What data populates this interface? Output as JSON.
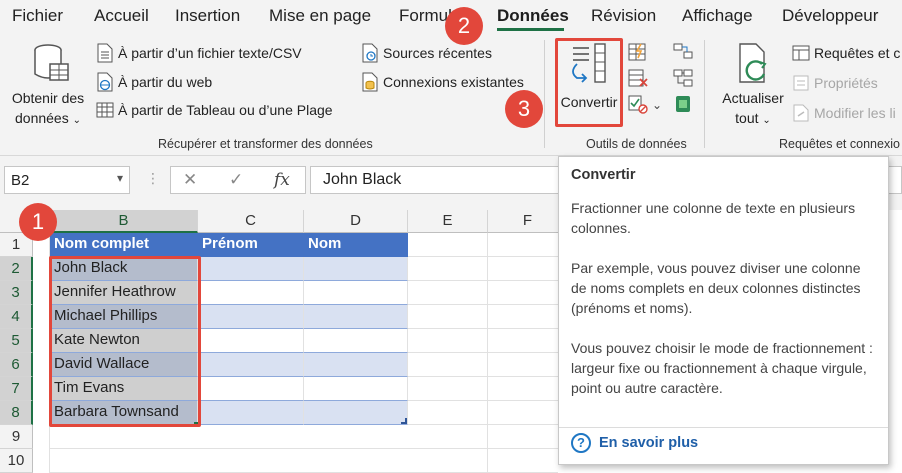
{
  "menu": {
    "tabs": [
      "Fichier",
      "Accueil",
      "Insertion",
      "Mise en page",
      "Formules",
      "Données",
      "Révision",
      "Affichage",
      "Développeur"
    ],
    "active": "Données"
  },
  "ribbon": {
    "get_data": {
      "line1": "Obtenir des",
      "line2": "données"
    },
    "text_csv": "À partir d’un fichier texte/CSV",
    "from_web": "À partir du web",
    "from_table": "À partir de Tableau ou d’une Plage",
    "recent_sources": "Sources récentes",
    "existing_connections": "Connexions existantes",
    "group_get": "Récupérer et transformer des données",
    "convert": "Convertir",
    "group_tools": "Outils de données",
    "refresh": {
      "line1": "Actualiser",
      "line2": "tout"
    },
    "queries": "Requêtes et c",
    "properties": "Propriétés",
    "edit_links": "Modifier les li",
    "group_queries": "Requêtes et connexio"
  },
  "formula_bar": {
    "name_box": "B2",
    "cancel": "✕",
    "enter": "✓",
    "fx": "fx",
    "value": "John Black"
  },
  "grid": {
    "columns": [
      "B",
      "C",
      "D",
      "E",
      "F"
    ],
    "rows": [
      "1",
      "2",
      "3",
      "4",
      "5",
      "6",
      "7",
      "8",
      "9",
      "10"
    ],
    "header_row": [
      "Nom complet",
      "Prénom",
      "Nom"
    ],
    "names": [
      "John Black",
      "Jennifer Heathrow",
      "Michael Phillips",
      "Kate Newton",
      "David Wallace",
      "Tim Evans",
      "Barbara Townsand"
    ]
  },
  "tooltip": {
    "title": "Convertir",
    "p1": "Fractionner une colonne de texte en plusieurs colonnes.",
    "p2": "Par exemple, vous pouvez diviser une colonne de noms complets en deux colonnes distinctes (prénoms et noms).",
    "p3": "Vous pouvez choisir le mode de fractionnement : largeur fixe ou fractionnement à chaque virgule, point ou autre caractère.",
    "help": "En savoir plus"
  },
  "steps": [
    "1",
    "2",
    "3"
  ],
  "colors": {
    "accent_green": "#1e7145",
    "table_header": "#4472c4",
    "table_band": "#d9e1f2",
    "annotation_red": "#e2473b",
    "link_blue": "#1f5fa8"
  }
}
